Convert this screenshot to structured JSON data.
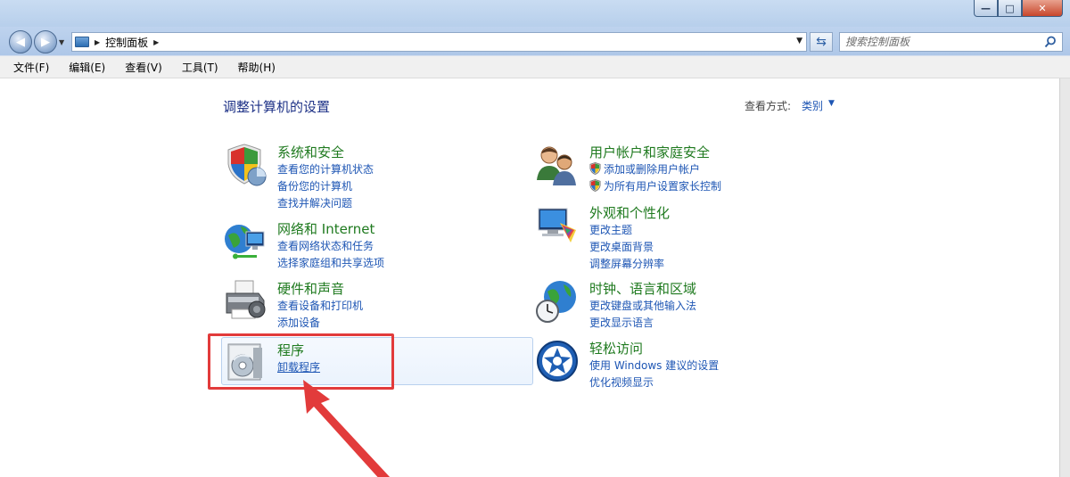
{
  "window": {
    "controls": {
      "minimize": "—",
      "maximize": "□",
      "close": "✕"
    }
  },
  "address": {
    "breadcrumb": "控制面板",
    "search_placeholder": "搜索控制面板"
  },
  "menu": [
    "文件(F)",
    "编辑(E)",
    "查看(V)",
    "工具(T)",
    "帮助(H)"
  ],
  "main": {
    "title": "调整计算机的设置",
    "view_by_label": "查看方式:",
    "view_by_value": "类别"
  },
  "categories": [
    {
      "title": "系统和安全",
      "links": [
        "查看您的计算机状态",
        "备份您的计算机",
        "查找并解决问题"
      ],
      "icon": "shield-icon"
    },
    {
      "title": "网络和 Internet",
      "links": [
        "查看网络状态和任务",
        "选择家庭组和共享选项"
      ],
      "icon": "network-globe-icon"
    },
    {
      "title": "硬件和声音",
      "links": [
        "查看设备和打印机",
        "添加设备"
      ],
      "icon": "printer-icon"
    },
    {
      "title": "程序",
      "links": [
        "卸载程序"
      ],
      "icon": "programs-icon"
    },
    {
      "title": "用户帐户和家庭安全",
      "links": [
        "添加或删除用户帐户",
        "为所有用户设置家长控制"
      ],
      "icon": "users-icon"
    },
    {
      "title": "外观和个性化",
      "links": [
        "更改主题",
        "更改桌面背景",
        "调整屏幕分辨率"
      ],
      "icon": "monitor-palette-icon"
    },
    {
      "title": "时钟、语言和区域",
      "links": [
        "更改键盘或其他输入法",
        "更改显示语言"
      ],
      "icon": "globe-clock-icon"
    },
    {
      "title": "轻松访问",
      "links": [
        "使用 Windows 建议的设置",
        "优化视频显示"
      ],
      "icon": "ease-of-access-icon"
    }
  ],
  "colors": {
    "title_blue": "#1e3287",
    "category_green": "#1f7a1f",
    "link_blue": "#1e56b4",
    "annotation_red": "#e23b3b"
  }
}
